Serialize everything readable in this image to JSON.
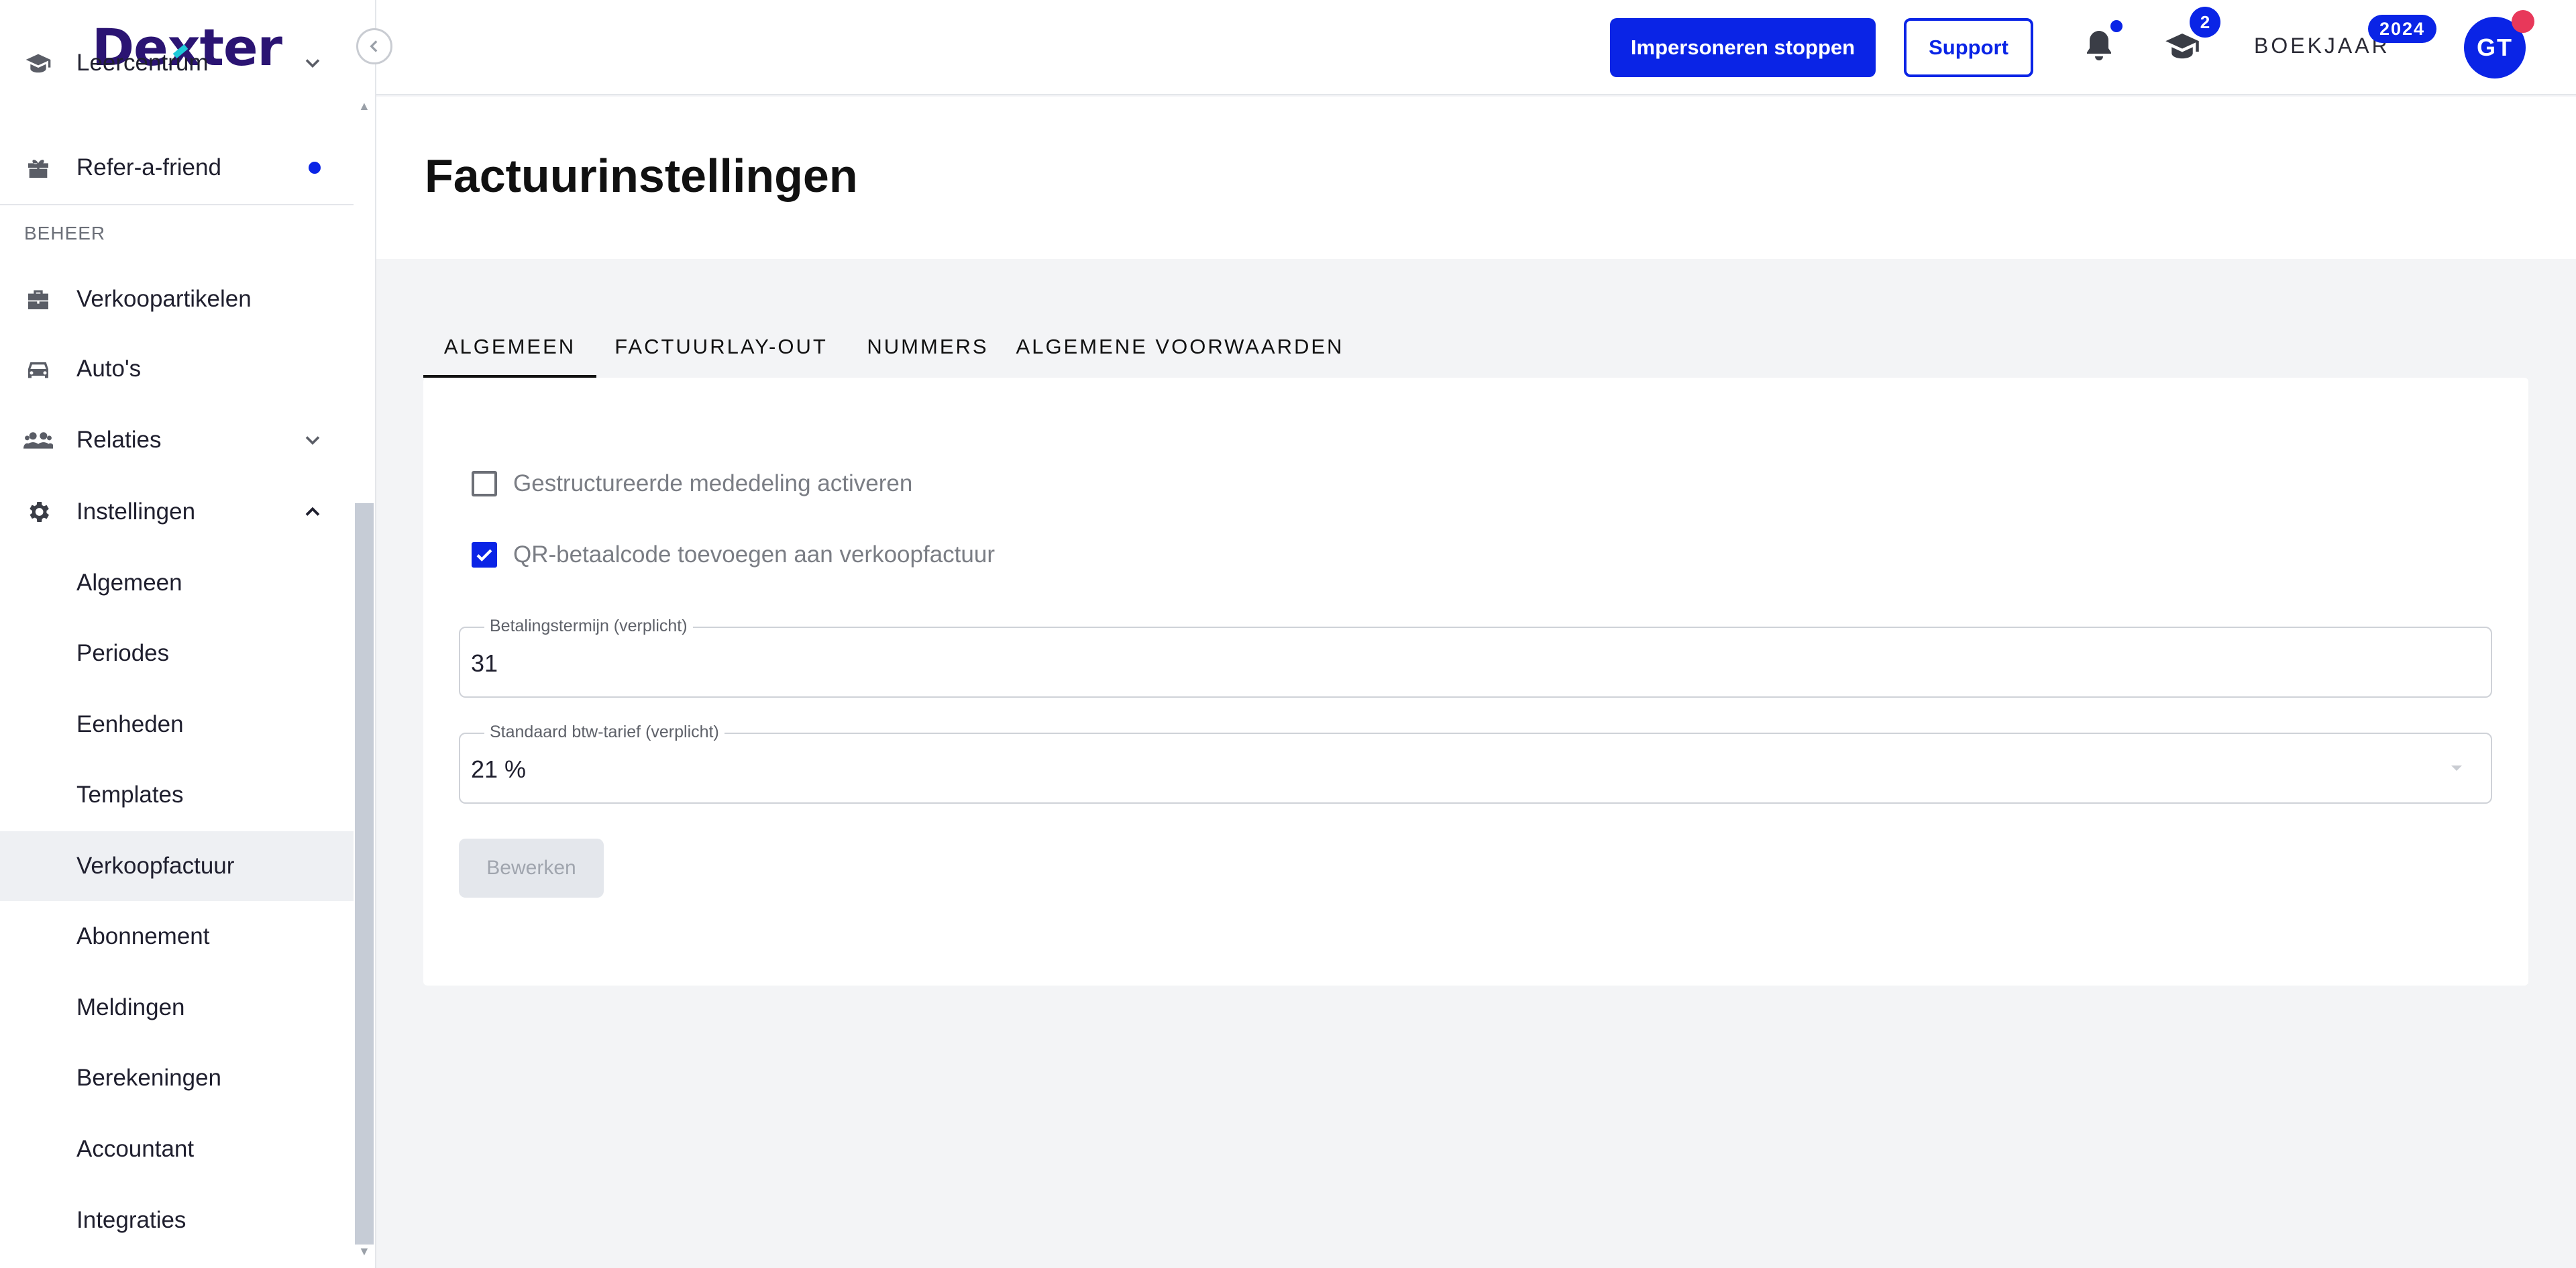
{
  "app": {
    "logo_text": "Dexter"
  },
  "sidebar": {
    "section_label": "BEHEER",
    "items": [
      {
        "label": "Leercentrum",
        "icon": "graduation-cap-icon"
      },
      {
        "label": "Refer-a-friend",
        "icon": "gift-icon"
      },
      {
        "label": "Verkoopartikelen",
        "icon": "briefcase-icon"
      },
      {
        "label": "Auto's",
        "icon": "car-icon"
      },
      {
        "label": "Relaties",
        "icon": "people-icon"
      },
      {
        "label": "Instellingen",
        "icon": "gear-icon"
      }
    ],
    "sub_items": [
      {
        "label": "Algemeen"
      },
      {
        "label": "Periodes"
      },
      {
        "label": "Eenheden"
      },
      {
        "label": "Templates"
      },
      {
        "label": "Verkoopfactuur"
      },
      {
        "label": "Abonnement"
      },
      {
        "label": "Meldingen"
      },
      {
        "label": "Berekeningen"
      },
      {
        "label": "Accountant"
      },
      {
        "label": "Integraties"
      }
    ],
    "active_sub_item": "Verkoopfactuur"
  },
  "topbar": {
    "impersonate_label": "Impersoneren stoppen",
    "support_label": "Support",
    "learning_badge_count": "2",
    "year_label": "BOEKJAAR",
    "year_value": "2024",
    "avatar_initials": "GT"
  },
  "page": {
    "title": "Factuurinstellingen",
    "tabs": [
      {
        "label": "ALGEMEEN",
        "active": true
      },
      {
        "label": "FACTUURLAY-OUT",
        "active": false
      },
      {
        "label": "NUMMERS",
        "active": false
      },
      {
        "label": "ALGEMENE VOORWAARDEN",
        "active": false
      }
    ]
  },
  "form": {
    "structured_message": {
      "label": "Gestructureerde mededeling activeren",
      "checked": false
    },
    "qr_code": {
      "label": "QR-betaalcode toevoegen aan verkoopfactuur",
      "checked": true
    },
    "payment_term": {
      "label": "Betalingstermijn (verplicht)",
      "value": "31"
    },
    "vat_rate": {
      "label": "Standaard btw-tarief (verplicht)",
      "value": "21 %"
    },
    "edit_button_label": "Bewerken"
  },
  "colors": {
    "brand": "#0a24e6",
    "logo": "#2b1473",
    "alert": "#e8385a"
  }
}
